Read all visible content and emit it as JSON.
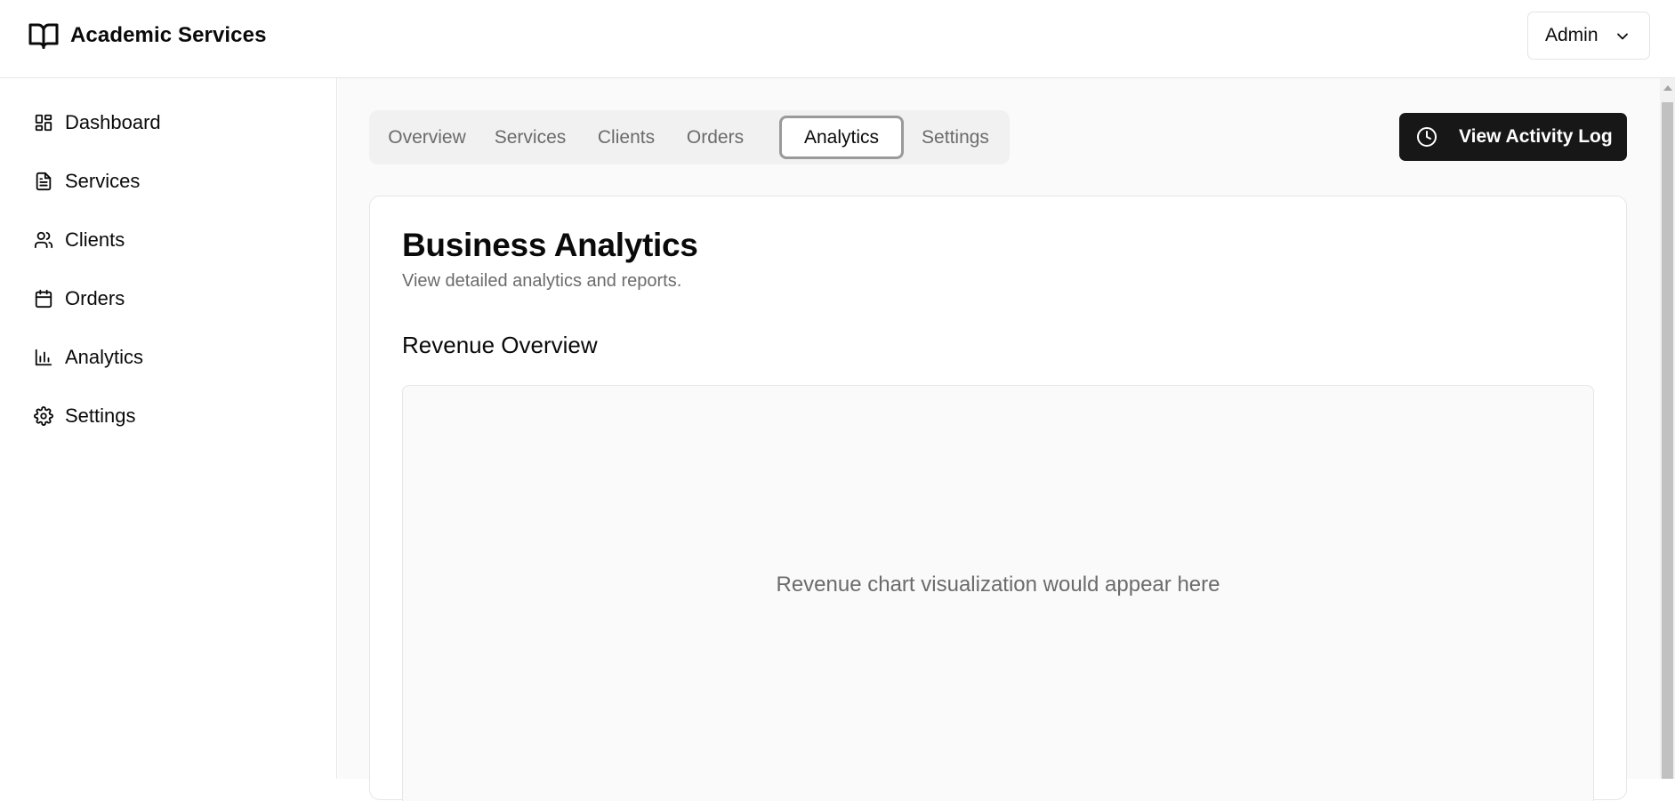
{
  "header": {
    "brand_icon": "book-open-icon",
    "title": "Academic Services",
    "user_menu": {
      "label": "Admin",
      "icon": "chevron-down-icon"
    }
  },
  "sidebar": {
    "items": [
      {
        "label": "Dashboard",
        "icon": "dashboard-icon"
      },
      {
        "label": "Services",
        "icon": "file-text-icon"
      },
      {
        "label": "Clients",
        "icon": "users-icon"
      },
      {
        "label": "Orders",
        "icon": "calendar-icon"
      },
      {
        "label": "Analytics",
        "icon": "bar-chart-icon"
      },
      {
        "label": "Settings",
        "icon": "gear-icon"
      }
    ]
  },
  "tabs": {
    "items": [
      "Overview",
      "Services",
      "Clients",
      "Orders",
      "Analytics",
      "Settings"
    ],
    "active": "Analytics"
  },
  "toolbar": {
    "activity_button": {
      "label": "View Activity Log",
      "icon": "clock-icon"
    }
  },
  "main": {
    "title": "Business Analytics",
    "subtitle": "View detailed analytics and reports.",
    "section_title": "Revenue Overview",
    "chart_placeholder": "Revenue chart visualization would appear here"
  },
  "colors": {
    "primary_button": "#171717",
    "muted_text": "#6b6b6b",
    "border": "#e6e6e6",
    "background_muted": "#fafafa"
  }
}
